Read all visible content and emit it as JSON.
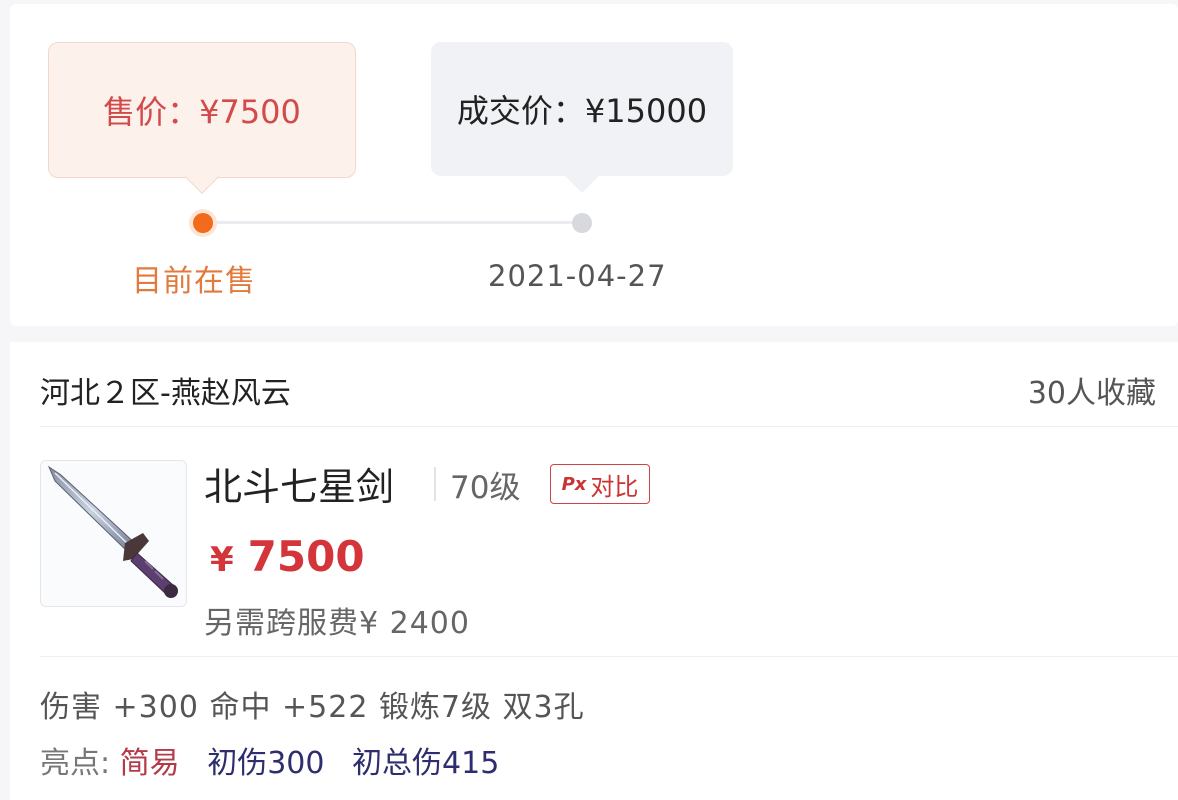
{
  "price_history": {
    "current": {
      "bubble_text": "售价：¥7500",
      "label": "目前在售"
    },
    "deal": {
      "bubble_text": "成交价：¥15000",
      "label": "2021-04-27"
    }
  },
  "listing": {
    "server": "河北２区-燕赵风云",
    "favorites": "30人收藏",
    "item_name": "北斗七星剑",
    "level": "70级",
    "compare_icon": "Px",
    "compare_label": "对比",
    "price_symbol": "¥",
    "price_value": "7500",
    "fee": "另需跨服费¥ 2400",
    "attributes": "伤害 +300 命中 +522 锻炼7级 双3孔",
    "highlights_label": "亮点:",
    "highlights": [
      {
        "text": "简易"
      },
      {
        "text": "初伤300"
      },
      {
        "text": "初总伤415"
      }
    ]
  },
  "colors": {
    "accent_orange": "#f26a1b",
    "price_red": "#d3353b",
    "highlight_blue": "#2e2e6e"
  }
}
